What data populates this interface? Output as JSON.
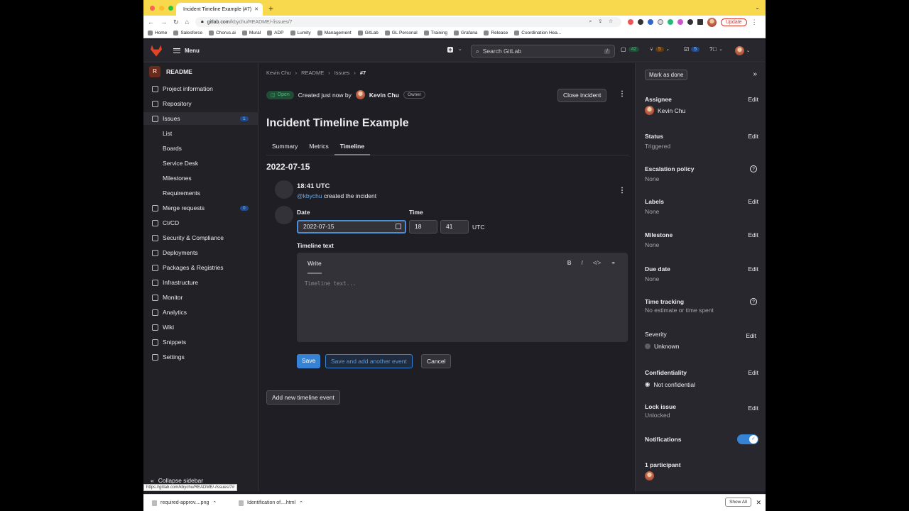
{
  "browser": {
    "tab_title": "Incident Timeline Example (#7)",
    "url_domain": "gitlab.com",
    "url_path": "/kbychu/README/-/issues/7",
    "update_label": "Update",
    "bookmarks": [
      "Home",
      "Salesforce",
      "Chorus.ai",
      "Mural",
      "ADP",
      "Lumity",
      "Management",
      "GitLab",
      "GL Personal",
      "Training",
      "Grafana",
      "Release",
      "Coordination Hea..."
    ]
  },
  "topbar": {
    "menu_label": "Menu",
    "search_placeholder": "Search GitLab",
    "search_shortcut": "/",
    "issues_count": "42",
    "mr_count": "5",
    "todo_count": "5"
  },
  "sidebar": {
    "project_initial": "R",
    "project_name": "README",
    "items": [
      {
        "label": "Project information",
        "icon": "info-icon"
      },
      {
        "label": "Repository",
        "icon": "doc-icon"
      },
      {
        "label": "Issues",
        "icon": "issues-icon",
        "count": "1"
      },
      {
        "label": "List"
      },
      {
        "label": "Boards"
      },
      {
        "label": "Service Desk"
      },
      {
        "label": "Milestones"
      },
      {
        "label": "Requirements"
      },
      {
        "label": "Merge requests",
        "icon": "merge-icon",
        "count": "0"
      },
      {
        "label": "CI/CD",
        "icon": "rocket-icon"
      },
      {
        "label": "Security & Compliance",
        "icon": "shield-icon"
      },
      {
        "label": "Deployments",
        "icon": "deploy-icon"
      },
      {
        "label": "Packages & Registries",
        "icon": "package-icon"
      },
      {
        "label": "Infrastructure",
        "icon": "cloud-icon"
      },
      {
        "label": "Monitor",
        "icon": "monitor-icon"
      },
      {
        "label": "Analytics",
        "icon": "chart-icon"
      },
      {
        "label": "Wiki",
        "icon": "book-icon"
      },
      {
        "label": "Snippets",
        "icon": "scissors-icon"
      },
      {
        "label": "Settings",
        "icon": "gear-icon"
      }
    ],
    "collapse_label": "Collapse sidebar",
    "status_url": "https://gitlab.com/kbychu/README/-/issues/7#"
  },
  "main": {
    "breadcrumbs": [
      "Kevin Chu",
      "README",
      "Issues",
      "#7"
    ],
    "status_badge": "Open",
    "created_text": "Created just now by",
    "author": "Kevin Chu",
    "role": "Owner",
    "close_label": "Close incident",
    "title": "Incident Timeline Example",
    "tabs": [
      "Summary",
      "Metrics",
      "Timeline"
    ],
    "date_heading": "2022-07-15",
    "event_time": "18:41 UTC",
    "event_user": "@kbychu",
    "event_action": "created the incident",
    "form": {
      "date_label": "Date",
      "date_value": "2022-07-15",
      "time_label": "Time",
      "hour": "18",
      "minute": "41",
      "tz": "UTC",
      "text_label": "Timeline text",
      "write_tab": "Write",
      "placeholder": "Timeline text...",
      "save": "Save",
      "save_another": "Save and add another event",
      "cancel": "Cancel"
    },
    "add_event": "Add new timeline event"
  },
  "right": {
    "mark_done": "Mark as done",
    "edit": "Edit",
    "assignee_h": "Assignee",
    "assignee_v": "Kevin Chu",
    "status_h": "Status",
    "status_v": "Triggered",
    "escalation_h": "Escalation policy",
    "escalation_v": "None",
    "labels_h": "Labels",
    "labels_v": "None",
    "milestone_h": "Milestone",
    "milestone_v": "None",
    "due_h": "Due date",
    "due_v": "None",
    "time_h": "Time tracking",
    "time_v": "No estimate or time spent",
    "severity_h": "Severity",
    "severity_v": "Unknown",
    "conf_h": "Confidentiality",
    "conf_v": "Not confidential",
    "lock_h": "Lock issue",
    "lock_v": "Unlocked",
    "notif_h": "Notifications",
    "participants_h": "1 participant"
  },
  "downloads": {
    "file1": "required-approv....png",
    "file2": "Identification of....html",
    "show_all": "Show All"
  },
  "colors": {
    "accent": "#3683d5",
    "open_badge": "#52b87a",
    "brand": "#e24329"
  }
}
